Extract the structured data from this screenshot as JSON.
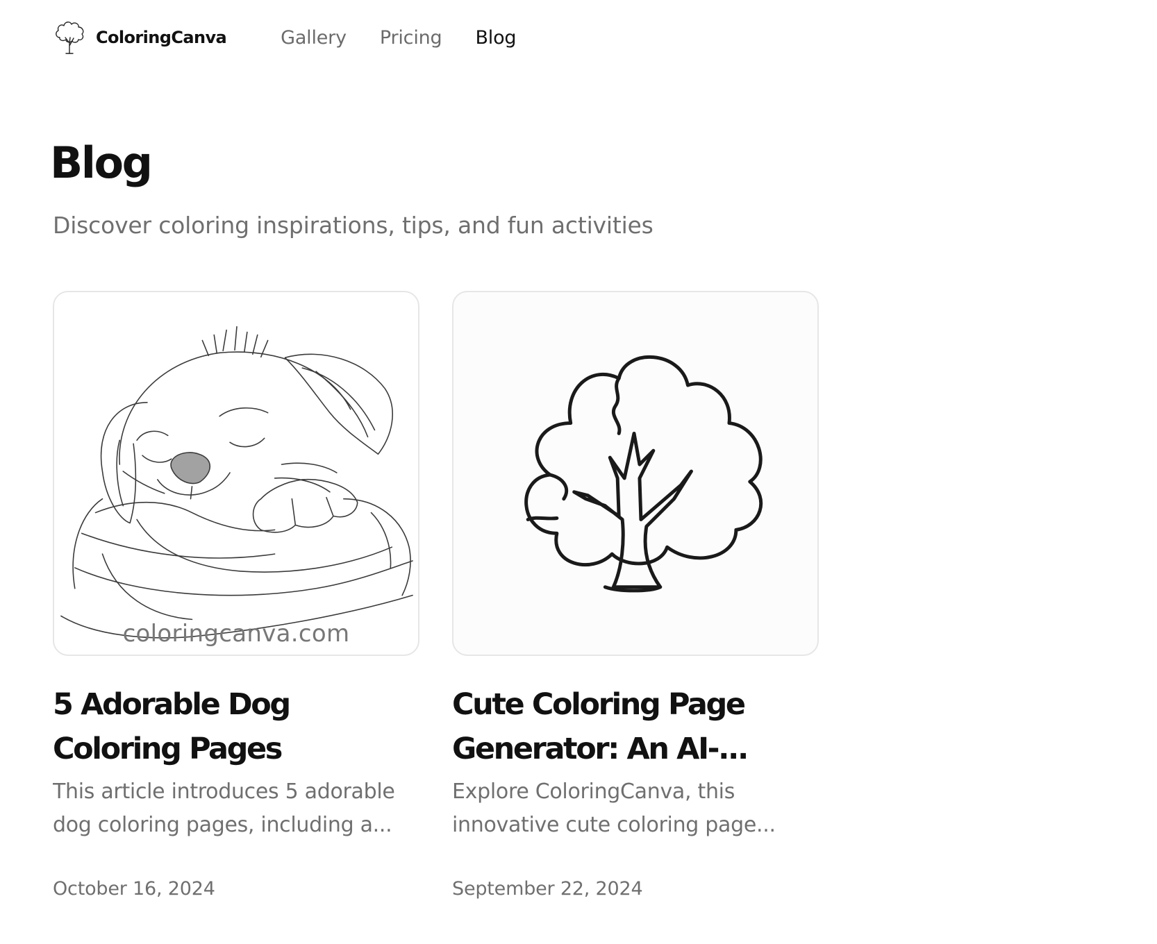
{
  "brand": {
    "name": "ColoringCanva",
    "logo_icon": "tree-logo-icon"
  },
  "nav": {
    "items": [
      {
        "label": "Gallery",
        "active": false
      },
      {
        "label": "Pricing",
        "active": false
      },
      {
        "label": "Blog",
        "active": true
      }
    ]
  },
  "hero": {
    "title": "Blog",
    "subtitle": "Discover coloring inspirations, tips, and fun activities"
  },
  "posts": [
    {
      "image_icon": "sleeping-puppy-illustration",
      "watermark": "coloringcanva.com",
      "title": "5 Adorable Dog Coloring Pages",
      "excerpt": "This article introduces 5 adorable dog coloring pages, including a...",
      "date": "October 16, 2024"
    },
    {
      "image_icon": "tree-illustration",
      "title": "Cute Coloring Page Generator: An AI-...",
      "excerpt": "Explore ColoringCanva, this innovative cute coloring page...",
      "date": "September 22, 2024"
    }
  ],
  "colors": {
    "text_primary": "#111111",
    "text_muted": "#6f6f6f",
    "card_border": "#e6e6e6"
  }
}
